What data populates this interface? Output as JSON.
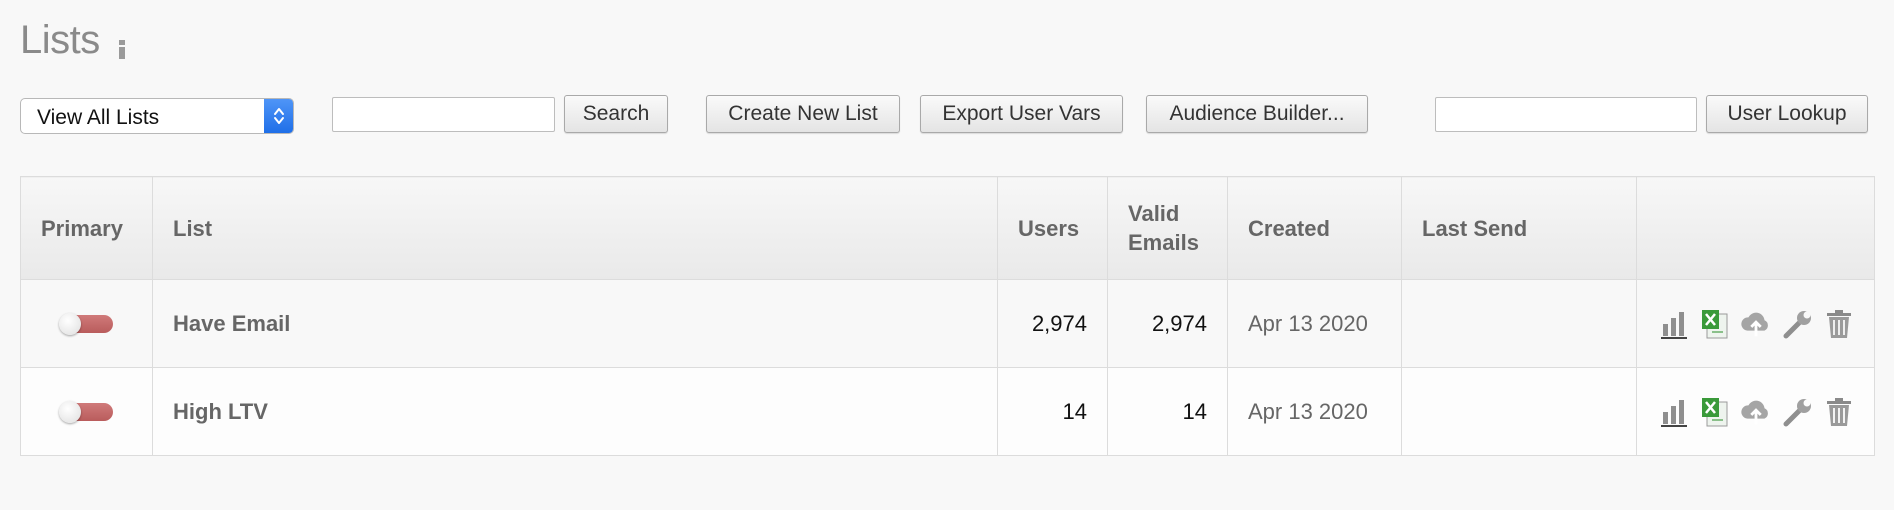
{
  "page": {
    "title": "Lists"
  },
  "toolbar": {
    "list_filter": {
      "selected": "View All Lists"
    },
    "search": {
      "value": "",
      "placeholder": "",
      "button_label": "Search"
    },
    "create_button_label": "Create New List",
    "export_button_label": "Export User Vars",
    "audience_button_label": "Audience Builder...",
    "user_lookup": {
      "value": "",
      "placeholder": "",
      "button_label": "User Lookup"
    }
  },
  "table": {
    "headers": {
      "primary": "Primary",
      "list": "List",
      "users": "Users",
      "valid_emails_line1": "Valid",
      "valid_emails_line2": "Emails",
      "created": "Created",
      "last_send": "Last Send"
    },
    "rows": [
      {
        "name": "Have Email",
        "users": "2,974",
        "valid_emails": "2,974",
        "created": "Apr 13 2020",
        "last_send": ""
      },
      {
        "name": "High LTV",
        "users": "14",
        "valid_emails": "14",
        "created": "Apr 13 2020",
        "last_send": ""
      }
    ]
  },
  "icons": {
    "info": "info-icon",
    "select_arrows": "chevron-up-down-icon",
    "row_actions": [
      "bar-chart-icon",
      "excel-export-icon",
      "cloud-upload-icon",
      "wrench-icon",
      "trash-icon"
    ]
  },
  "colors": {
    "select_accent": "#2b7bf0",
    "toggle_off": "#c46a6a",
    "title_gray": "#8a8a8a",
    "excel_green": "#3a9a3a"
  }
}
